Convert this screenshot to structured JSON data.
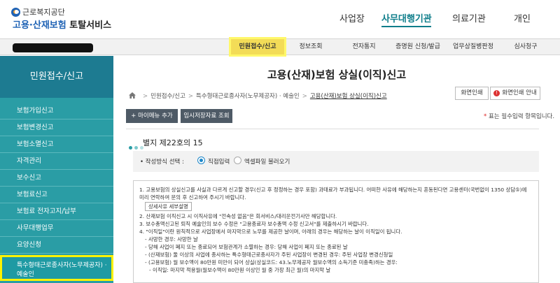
{
  "header": {
    "org_name": "근로복지공단",
    "service_name_prefix": "고용·산재보험",
    "service_name_suffix": "토탈서비스",
    "nav": [
      "사업장",
      "사무대행기관",
      "의료기관",
      "개인"
    ],
    "active_nav": "사무대행기관"
  },
  "subnav": {
    "items": [
      "민원접수/신고",
      "정보조회",
      "전자통지",
      "증명원 신청/발급",
      "업무상질병판정",
      "심사청구"
    ],
    "selected": "민원접수/신고"
  },
  "sidebar": {
    "title": "민원접수/신고",
    "items": [
      "보험가입신고",
      "보험변경신고",
      "보험소멸신고",
      "자격관리",
      "보수신고",
      "보험료신고",
      "보험료 전자고지/납부",
      "사무대행업무",
      "요양신청",
      "특수형태근로종사자(노무제공자) · 예술인"
    ]
  },
  "main": {
    "title": "고용(산재)보험 상실(이직)신고",
    "breadcrumb": [
      "민원접수/신고",
      "특수형태근로종사자(노무제공자) · 예술인",
      "고용(산재)보험 상실(이직)신고"
    ],
    "print_button": "화면인쇄",
    "print_guide_button": "화면인쇄 안내",
    "add_menu_button": "+ 마이메뉴 추가",
    "temp_save_button": "임시저장자료 조회",
    "required_note_star": "*",
    "required_note": "표는 필수입력 항목입니다.",
    "form_title": "별지 제22호의 15",
    "method_label": "• 작성방식 선택 :",
    "method_options": [
      "직접입력",
      "엑셀파일 불러오기"
    ],
    "method_selected": "직접입력",
    "detail_button": "상세사유 세부설명",
    "notice_lines": [
      "1. 고용보험의 상실신고를 사실과 다르게 신고할 경우(신고 후 정정하는 경우 포함) 과태료가 부과됩니다. 어떠한 사유에 해당하는지 혼동된다면 고용센터(국번없이 1350 상담⑤)에 미리 연락하여 문의 후 신고하여 주시기 바랍니다.",
      "2. 산재보험 이직신고 시 이직사유에 \"전속성 없음\"은 회서비스/대리운전기사만 해당합니다.",
      "3. 보수총액신고된 퇴직 예술인의 보수 수정은 \"고용종료자 보수총액 수정 신고서\"를 제출하시기 바랍니다.",
      "4. \"이직일\"이란 원칙적으로 사업장에서 마지막으로 노무를 제공한 날이며, 아래의 경우는 해당하는 날이 이직일이 됩니다.",
      "- 사망한 경우: 사망한 날",
      "- 당해 사업이 폐지 또는 종료되어 보험관계가 소멸하는 경우: 당해 사업이 폐지 또는 종료된 날",
      "- (산재보험) 둘 이상의 사업에 종사하는 특수형태근로종사자가 주된 사업장이 변경된 경우: 주된 사업장 변경신청일",
      "- (고용보험) 월 보수액이 80만원 미만이 되어 상실(상실코드: 43.노무제공자 월보수액의 소득기준 미충족)하는 경우:",
      "- 이직일: 마지막 적용월(월보수액이 80만원 이상인 월 중 가장 최근 월)의 마지막 날"
    ]
  },
  "colors": {
    "brand_blue": "#1f63b5",
    "teal_active": "#0d7d8a",
    "sidebar_bg": "#2a9da5",
    "sidebar_title_bg": "#1d7b91",
    "highlight_yellow": "#fff200",
    "dot_colors": [
      "#2a9da5",
      "#7cc8cc",
      "#b9e1e3"
    ]
  },
  "icons": [
    "home-icon",
    "print-guide-icon",
    "radio-icon",
    "dot-icon"
  ]
}
